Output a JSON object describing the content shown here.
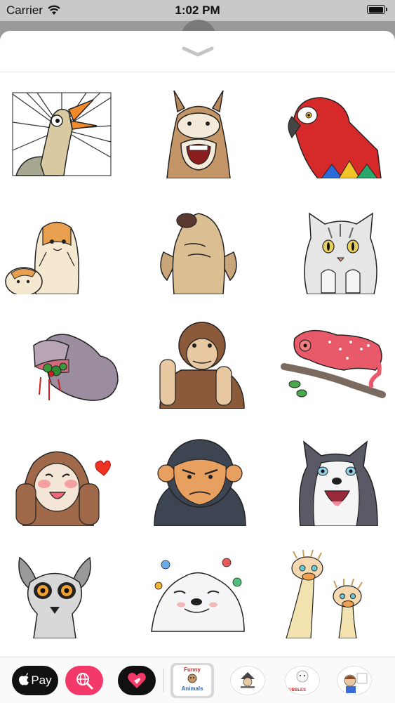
{
  "status_bar": {
    "carrier": "Carrier",
    "time": "1:02 PM"
  },
  "sheet": {
    "handle_icon": "chevron-down-icon"
  },
  "stickers": [
    {
      "name": "goose-shocked"
    },
    {
      "name": "donkey-laughing"
    },
    {
      "name": "parrot"
    },
    {
      "name": "guinea-pigs"
    },
    {
      "name": "dog-smug"
    },
    {
      "name": "cat-begging"
    },
    {
      "name": "hippo-eating"
    },
    {
      "name": "monkey-thinking"
    },
    {
      "name": "chameleon"
    },
    {
      "name": "otter-love"
    },
    {
      "name": "chimpanzee-angry"
    },
    {
      "name": "husky-laughing"
    },
    {
      "name": "lemur-shocked"
    },
    {
      "name": "seal-flowers"
    },
    {
      "name": "ostriches"
    }
  ],
  "app_drawer": {
    "apple_pay_label": "Pay",
    "packs": [
      {
        "label_top": "Funny",
        "label_bottom": "Animals"
      },
      {
        "label": ""
      },
      {
        "label": "BUBBLES"
      },
      {
        "label": ""
      }
    ]
  }
}
